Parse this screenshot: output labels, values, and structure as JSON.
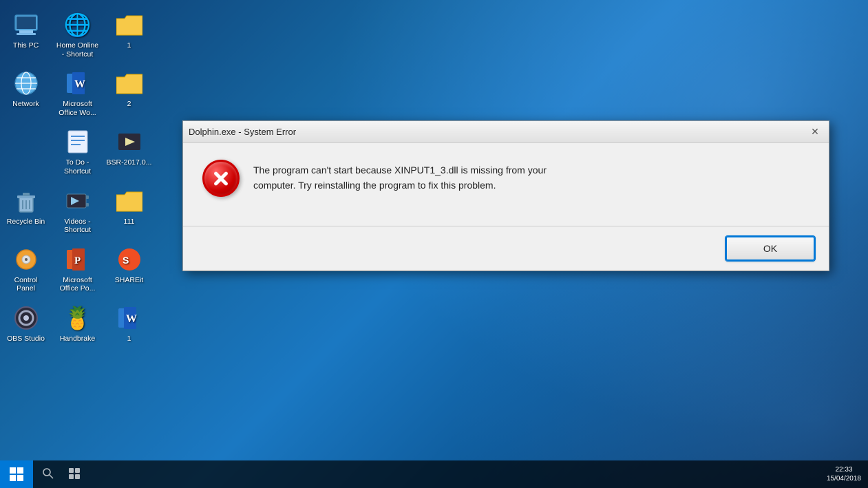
{
  "desktop": {
    "icons": [
      {
        "id": "this-pc",
        "label": "This PC",
        "emoji": "🖥️",
        "col": 0
      },
      {
        "id": "home-online",
        "label": "Home Online\n- Shortcut",
        "emoji": "🌐",
        "col": 1
      },
      {
        "id": "item-1",
        "label": "1",
        "emoji": "📁",
        "col": 2
      },
      {
        "id": "network",
        "label": "Network",
        "emoji": "🌐",
        "col": 0
      },
      {
        "id": "ms-office-word",
        "label": "Microsoft\nOffice Wo...",
        "emoji": "📝",
        "col": 1
      },
      {
        "id": "item-2",
        "label": "2",
        "emoji": "📁",
        "col": 2
      },
      {
        "id": "todo-shortcut",
        "label": "To Do -\nShortcut",
        "emoji": "📋",
        "col": 1
      },
      {
        "id": "bsr",
        "label": "BSR-2017.0...",
        "emoji": "🎬",
        "col": 2
      },
      {
        "id": "recycle-bin",
        "label": "Recycle Bin",
        "emoji": "🗑️",
        "col": 0
      },
      {
        "id": "videos-shortcut",
        "label": "Videos -\nShortcut",
        "emoji": "🎬",
        "col": 1
      },
      {
        "id": "item-111",
        "label": "111",
        "emoji": "📁",
        "col": 2
      },
      {
        "id": "control-panel",
        "label": "Control\nPanel",
        "emoji": "⚙️",
        "col": 0
      },
      {
        "id": "ms-office-po",
        "label": "Microsoft\nOffice Po...",
        "emoji": "📊",
        "col": 1
      },
      {
        "id": "shareit",
        "label": "SHAREit",
        "emoji": "🔄",
        "col": 0
      },
      {
        "id": "obs-studio",
        "label": "OBS Studio",
        "emoji": "🎙️",
        "col": 1
      },
      {
        "id": "handbrake",
        "label": "Handbrake",
        "emoji": "🍍",
        "col": 0
      },
      {
        "id": "item-1b",
        "label": "1",
        "emoji": "📝",
        "col": 1
      }
    ]
  },
  "dialog": {
    "title": "Dolphin.exe - System Error",
    "close_label": "✕",
    "message_line1": "The program can't start because XINPUT1_3.dll is missing from your",
    "message_line2": "computer. Try reinstalling the program to fix this problem.",
    "ok_label": "OK"
  },
  "taskbar": {
    "clock_time": "22:33",
    "clock_date": "15/04/2018"
  }
}
